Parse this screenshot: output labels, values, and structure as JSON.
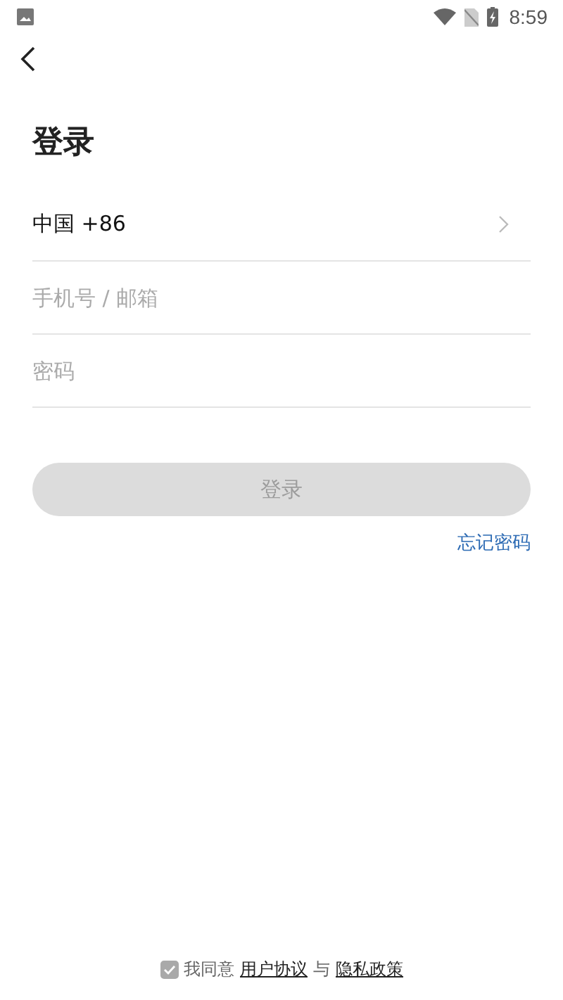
{
  "status_bar": {
    "time": "8:59"
  },
  "title": "登录",
  "country": {
    "value": "中国 +86"
  },
  "fields": [
    {
      "placeholder": "手机号 / 邮箱"
    },
    {
      "placeholder": "密码"
    }
  ],
  "login_button": {
    "label": "登录",
    "disabled": true
  },
  "forgot_link": "忘记密码",
  "agreement": {
    "checked": true,
    "prefix": "我同意",
    "terms_link": "用户协议",
    "joiner": "与",
    "privacy_link": "隐私政策"
  }
}
